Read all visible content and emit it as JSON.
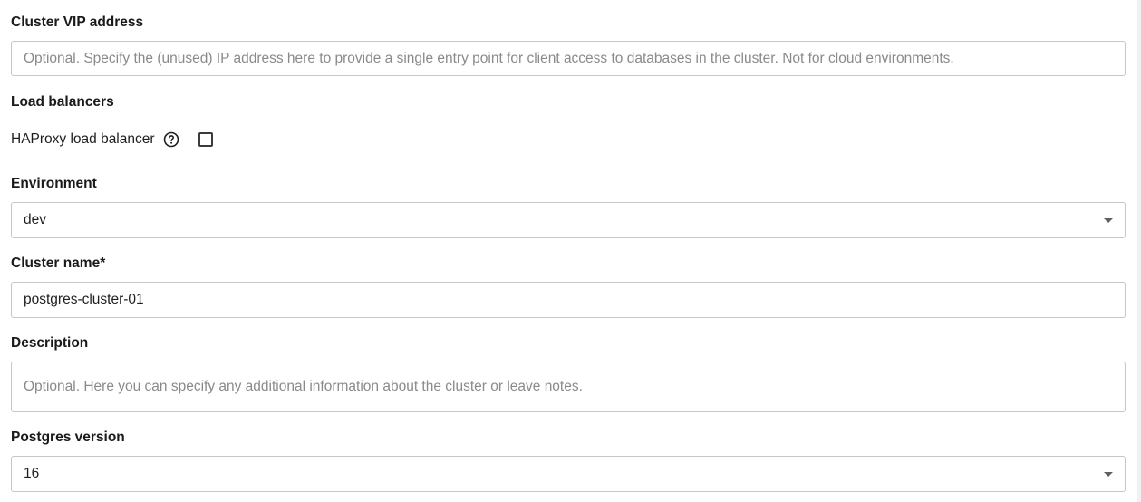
{
  "vip": {
    "label": "Cluster VIP address",
    "placeholder": "Optional. Specify the (unused) IP address here to provide a single entry point for client access to databases in the cluster. Not for cloud environments."
  },
  "load_balancers": {
    "label": "Load balancers",
    "haproxy_label": "HAProxy load balancer",
    "help_icon": "help-circle-icon",
    "haproxy_checked": false
  },
  "environment": {
    "label": "Environment",
    "value": "dev"
  },
  "cluster_name": {
    "label": "Cluster name*",
    "value": "postgres-cluster-01"
  },
  "description": {
    "label": "Description",
    "placeholder": "Optional. Here you can specify any additional information about the cluster or leave notes."
  },
  "postgres_version": {
    "label": "Postgres version",
    "value": "16"
  }
}
